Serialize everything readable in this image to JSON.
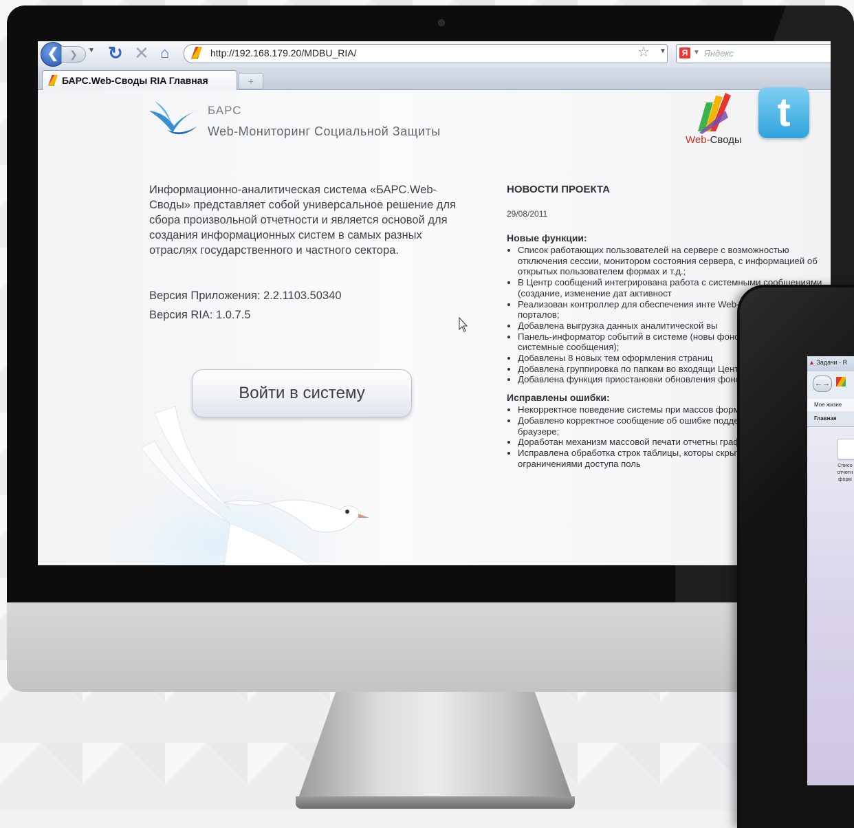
{
  "browser": {
    "url": "http://192.168.179.20/MDBU_RIA/",
    "search_placeholder": "Яндекс",
    "search_engine_badge": "Я",
    "tab_title": "БАРС.Web-Своды RIA Главная",
    "new_tab_label": "+"
  },
  "header": {
    "brand_small": "БАРС",
    "brand_big": "Web-Мониторинг Социальной Защиты",
    "ws_logo_part1": "Web-",
    "ws_logo_part2": "Своды",
    "twitter_letter": "t"
  },
  "main": {
    "description": "Информационно-аналитическая система «БАРС.Web-Своды» представляет собой универсальное решение для сбора произвольной отчетности и является основой для создания информационных систем в самых разных отраслях государственного и частного сектора.",
    "app_version": "Версия Приложения: 2.2.1103.50340",
    "ria_version": "Версия RIA: 1.0.7.5",
    "login_button": "Войти в систему"
  },
  "news": {
    "title": "НОВОСТИ ПРОЕКТА",
    "date": "29/08/2011",
    "new_features_heading": "Новые функции:",
    "new_features": [
      "Список работающих пользователей на сервере с возможностью отключения сессии, монитором состояния сервера, с информацией об открытых пользователем формах и т.д.;",
      "В Центр сообщений интегрирована работа с системными сообщениями (создание, изменение дат активност",
      "Реализован контроллер для обеспечения инте Web-Аналитики и порталов;",
      "Добавлена выгрузка данных аналитической вы",
      "Панель-информатор событий в системе (новы фоновые процессы, системные сообщения);",
      "Добавлены 8 новых тем оформления страниц",
      "Добавлена группировка по папкам во входящи Центра сообщений;",
      "Добавлена функция приостановки обновления фоновых процессов;"
    ],
    "fixes_heading": "Исправлены ошибки:",
    "fixes": [
      "Некорректное поведение системы при массов форм;",
      "Добавлено корректное сообщение об ошибке поддержки ЭЦП в браузере;",
      "Доработан механизм массовой печати отчетны графа Учреждение);",
      "Исправлена обработка строк таблицы, которы скрыты в связи с ограничениями доступа поль"
    ]
  },
  "tablet": {
    "tab_text": "Задачи - R",
    "life_text": "Мое жизне",
    "main_tab": "Главная",
    "doc_label_1": "Списо",
    "doc_label_2": "отчетн",
    "doc_label_3": "форм"
  }
}
